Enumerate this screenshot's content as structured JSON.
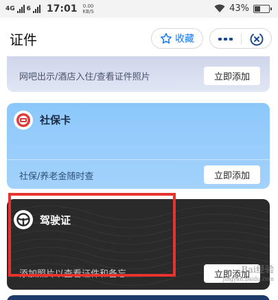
{
  "status_bar": {
    "network": "4G",
    "network2": "6",
    "time": "17:01",
    "speed_value": "0.00",
    "speed_unit": "KB/S",
    "battery_percent": "43%",
    "battery_level": 0.43
  },
  "header": {
    "title": "证件",
    "favorite_label": "收藏",
    "more_icon": "more-icon",
    "close_icon": "close-circle-icon"
  },
  "cards": [
    {
      "name": "",
      "description": "网吧出示/酒店入住/查看证件照片",
      "action_label": "立即添加",
      "color": "#cfd6ec"
    },
    {
      "name": "社保卡",
      "description": "社保/养老金随时查",
      "action_label": "立即添加",
      "icon": "social-security-icon",
      "color": "#8cc8fb"
    },
    {
      "name": "驾驶证",
      "description": "添加照片以查看证件和备忘",
      "action_label": "立即添加",
      "icon": "steering-wheel-icon",
      "color": "#2a2a2a"
    }
  ],
  "annotation": {
    "highlight_color": "#e8322e"
  },
  "watermark": {
    "line1": "Bai经验",
    "line2": "jingyan.baidu.com"
  },
  "colors": {
    "accent": "#1677ff"
  }
}
